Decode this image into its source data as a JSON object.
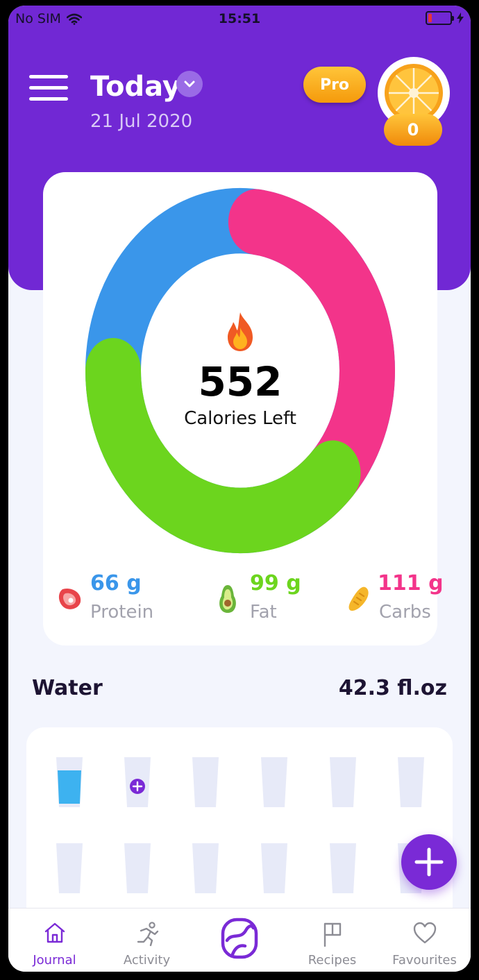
{
  "status_bar": {
    "carrier": "No SIM",
    "time": "15:51"
  },
  "header": {
    "title": "Today",
    "date": "21 Jul 2020",
    "pro_label": "Pro",
    "coin_count": "0",
    "background_color": "#7128d4"
  },
  "summary": {
    "calories_left": "552",
    "calories_label": "Calories Left",
    "macros": [
      {
        "name": "protein",
        "value": "66 g",
        "label": "Protein",
        "color": "#3a96ea"
      },
      {
        "name": "fat",
        "value": "99 g",
        "label": "Fat",
        "color": "#6cd51e"
      },
      {
        "name": "carbs",
        "value": "111 g",
        "label": "Carbs",
        "color": "#f3348a"
      }
    ]
  },
  "water": {
    "title": "Water",
    "amount": "42.3 fl.oz",
    "glasses_filled": 1,
    "fill_color": "#3db2f0"
  },
  "add_button_icon": "plus-icon",
  "tabbar": {
    "tabs": [
      {
        "label": "Journal",
        "icon": "home-icon",
        "active": true
      },
      {
        "label": "Activity",
        "icon": "running-icon",
        "active": false
      },
      {
        "label": "",
        "icon": "app-logo-icon",
        "active": false
      },
      {
        "label": "Recipes",
        "icon": "flag-icon",
        "active": false
      },
      {
        "label": "Favourites",
        "icon": "heart-icon",
        "active": false
      }
    ]
  }
}
